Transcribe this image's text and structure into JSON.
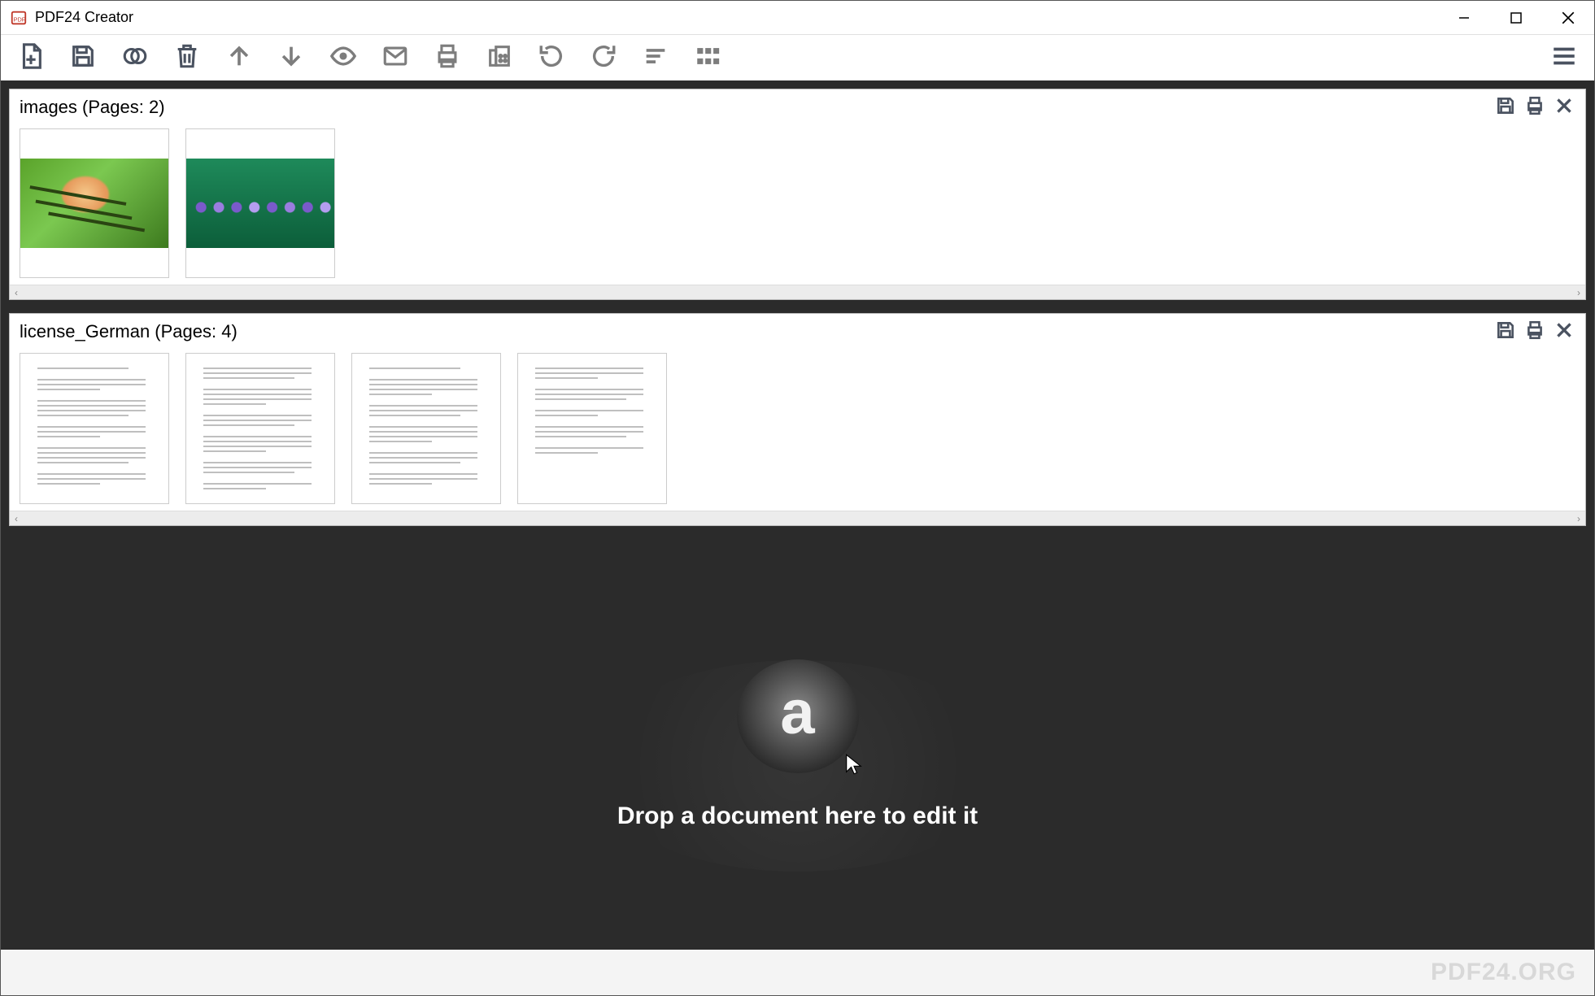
{
  "window": {
    "title": "PDF24 Creator"
  },
  "documents": [
    {
      "name": "images",
      "page_count": 2,
      "label": "images (Pages: 2)",
      "thumb_kind": "photo"
    },
    {
      "name": "license_German",
      "page_count": 4,
      "label": "license_German (Pages: 4)",
      "thumb_kind": "textpage"
    }
  ],
  "dropzone": {
    "text": "Drop a document here to edit it"
  },
  "footer": {
    "brand": "PDF24.ORG"
  },
  "scroll": {
    "left_glyph": "‹",
    "right_glyph": "›"
  },
  "toolbar_icons": [
    "new-file-icon",
    "save-icon",
    "merge-icon",
    "delete-icon",
    "move-up-icon",
    "move-down-icon",
    "preview-icon",
    "email-icon",
    "print-icon",
    "fax-icon",
    "rotate-left-icon",
    "rotate-right-icon",
    "sort-icon",
    "grid-icon"
  ],
  "doc_action_icons": [
    "save-icon",
    "print-icon",
    "close-icon"
  ]
}
